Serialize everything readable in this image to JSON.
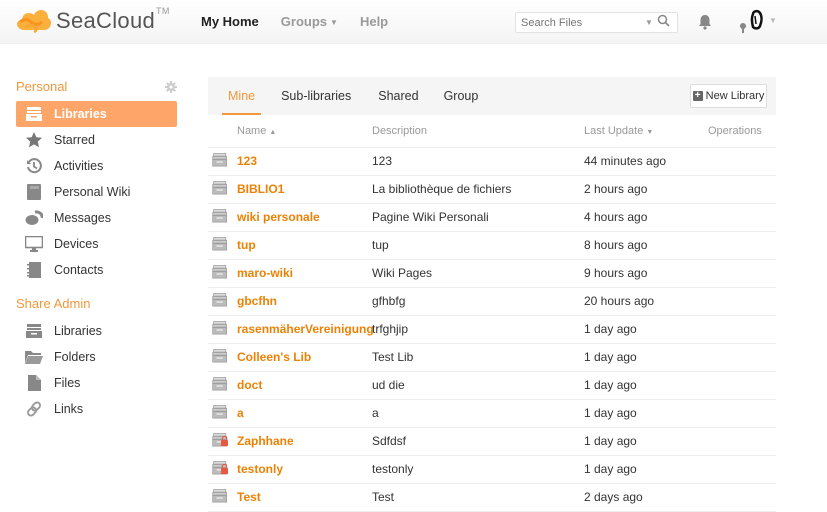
{
  "header": {
    "logo_text_main": "SeaCloud",
    "logo_tm": "TM",
    "nav": [
      {
        "label": "My Home",
        "active": true
      },
      {
        "label": "Groups",
        "dropdown": true
      },
      {
        "label": "Help"
      }
    ],
    "search_placeholder": "Search Files",
    "icons": [
      "search-icon",
      "bell-icon",
      "avatar"
    ]
  },
  "sidebar": {
    "personal_heading": "Personal",
    "personal_items": [
      {
        "label": "Libraries",
        "icon": "library-icon",
        "active": true
      },
      {
        "label": "Starred",
        "icon": "star-icon"
      },
      {
        "label": "Activities",
        "icon": "clock-icon"
      },
      {
        "label": "Personal Wiki",
        "icon": "wiki-icon"
      },
      {
        "label": "Messages",
        "icon": "messages-icon"
      },
      {
        "label": "Devices",
        "icon": "monitor-icon"
      },
      {
        "label": "Contacts",
        "icon": "contacts-icon"
      }
    ],
    "admin_heading": "Share Admin",
    "admin_items": [
      {
        "label": "Libraries",
        "icon": "library-icon"
      },
      {
        "label": "Folders",
        "icon": "folder-icon"
      },
      {
        "label": "Files",
        "icon": "file-icon"
      },
      {
        "label": "Links",
        "icon": "link-icon"
      }
    ]
  },
  "main": {
    "tabs": [
      {
        "label": "Mine",
        "active": true
      },
      {
        "label": "Sub-libraries"
      },
      {
        "label": "Shared"
      },
      {
        "label": "Group"
      }
    ],
    "new_library_label": "New Library",
    "columns": {
      "name": "Name",
      "description": "Description",
      "last_update": "Last Update",
      "operations": "Operations"
    },
    "rows": [
      {
        "name": "123",
        "description": "123",
        "updated": "44 minutes ago",
        "encrypted": false
      },
      {
        "name": "BIBLIO1",
        "description": "La bibliothèque de fichiers",
        "updated": "2 hours ago",
        "encrypted": false
      },
      {
        "name": "wiki personale",
        "description": "Pagine Wiki Personali",
        "updated": "4 hours ago",
        "encrypted": false
      },
      {
        "name": "tup",
        "description": "tup",
        "updated": "8 hours ago",
        "encrypted": false
      },
      {
        "name": "maro-wiki",
        "description": "Wiki Pages",
        "updated": "9 hours ago",
        "encrypted": false
      },
      {
        "name": "gbcfhn",
        "description": "gfhbfg",
        "updated": "20 hours ago",
        "encrypted": false
      },
      {
        "name": "rasenmäherVereinigung",
        "description": "trfghjip",
        "updated": "1 day ago",
        "encrypted": false
      },
      {
        "name": "Colleen's Lib",
        "description": "Test Lib",
        "updated": "1 day ago",
        "encrypted": false
      },
      {
        "name": "doct",
        "description": "ud die",
        "updated": "1 day ago",
        "encrypted": false
      },
      {
        "name": "a",
        "description": "a",
        "updated": "1 day ago",
        "encrypted": false
      },
      {
        "name": "Zaphhane",
        "description": "Sdfdsf",
        "updated": "1 day ago",
        "encrypted": true
      },
      {
        "name": "testonly",
        "description": "testonly",
        "updated": "1 day ago",
        "encrypted": true
      },
      {
        "name": "Test",
        "description": "Test",
        "updated": "2 days ago",
        "encrypted": false
      }
    ]
  },
  "colors": {
    "accent": "#f2983b",
    "active_item_bg": "#fea56a",
    "link": "#eb8205",
    "lock": "#e8573f"
  }
}
